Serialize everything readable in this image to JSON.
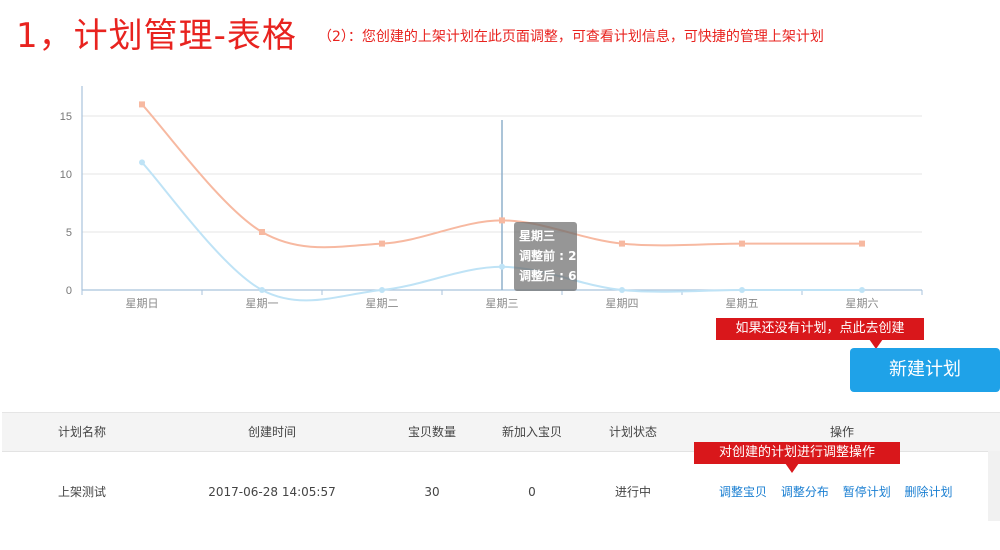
{
  "heading": "1，计划管理-表格",
  "subheading": "（2）：您创建的上架计划在此页面调整，可查看计划信息，可快捷的管理上架计划",
  "chart_data": {
    "type": "line",
    "categories": [
      "星期日",
      "星期一",
      "星期二",
      "星期三",
      "星期四",
      "星期五",
      "星期六"
    ],
    "series": [
      {
        "name": "调整前",
        "values": [
          11,
          0,
          0,
          2,
          0,
          0,
          0
        ],
        "color": "#bfe3f6"
      },
      {
        "name": "调整后",
        "values": [
          16,
          5,
          4,
          6,
          4,
          4,
          4
        ],
        "color": "#f7b9a1"
      }
    ],
    "yticks": [
      0,
      5,
      10,
      15
    ],
    "ylim": [
      0,
      15
    ],
    "grid": true,
    "smooth": true,
    "axis_color": "#a9c3dc",
    "tooltip": {
      "category": "星期三",
      "lines": [
        "调整前 : 2",
        "调整后 : 6"
      ]
    }
  },
  "callouts": {
    "create": "如果还没有计划，点此去创建",
    "adjust": "对创建的计划进行调整操作"
  },
  "new_plan_button": "新建计划",
  "table": {
    "headers": [
      "计划名称",
      "创建时间",
      "宝贝数量",
      "新加入宝贝",
      "计划状态",
      "操作"
    ],
    "rows": [
      {
        "name": "上架测试",
        "created": "2017-06-28 14:05:57",
        "count": "30",
        "new_count": "0",
        "status": "进行中",
        "actions": [
          "调整宝贝",
          "调整分布",
          "暂停计划",
          "删除计划"
        ]
      }
    ]
  }
}
